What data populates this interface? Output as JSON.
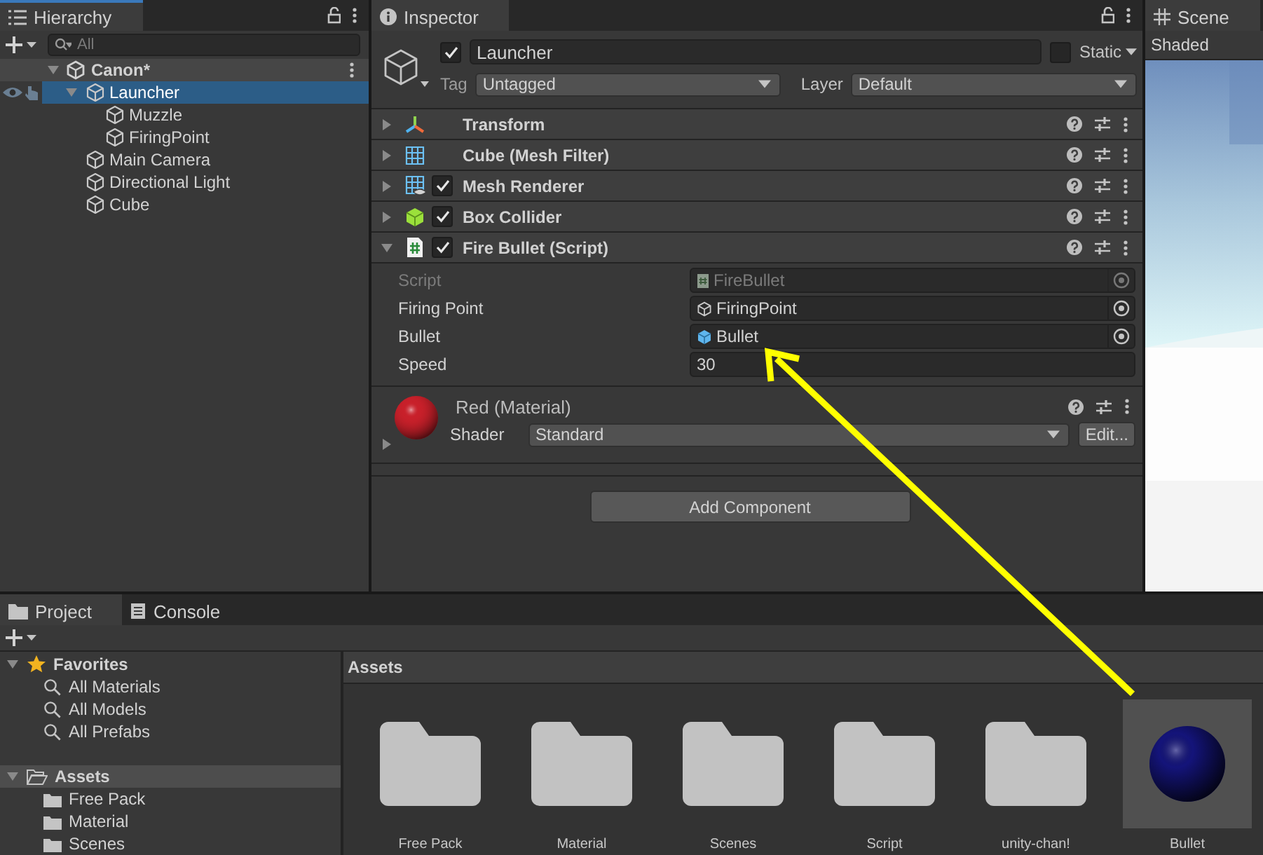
{
  "hierarchy": {
    "tab": {
      "label": "Hierarchy",
      "focused": true
    },
    "search": {
      "placeholder": "All"
    },
    "scene_root": {
      "label": "Canon*",
      "expanded": true
    },
    "items": [
      {
        "label": "Launcher",
        "selected": true,
        "expanded": true,
        "children": [
          {
            "label": "Muzzle",
            "selected": false
          },
          {
            "label": "FiringPoint",
            "selected": false
          }
        ]
      },
      {
        "label": "Main Camera",
        "selected": false
      },
      {
        "label": "Directional Light",
        "selected": false
      },
      {
        "label": "Cube",
        "selected": false
      }
    ]
  },
  "inspector": {
    "tab": {
      "label": "Inspector",
      "focused": false
    },
    "object": {
      "name": "Launcher",
      "active": true,
      "static_label": "Static",
      "static": false,
      "tag_label": "Tag",
      "tag": "Untagged",
      "layer_label": "Layer",
      "layer": "Default"
    },
    "components": [
      {
        "kind": "transform",
        "title": "Transform",
        "expanded": false
      },
      {
        "kind": "mesh-filter",
        "title": "Cube (Mesh Filter)",
        "expanded": false
      },
      {
        "kind": "mesh-renderer",
        "title": "Mesh Renderer",
        "enabled": true,
        "expanded": false
      },
      {
        "kind": "box-collider",
        "title": "Box Collider",
        "enabled": true,
        "expanded": false
      },
      {
        "kind": "script",
        "title": "Fire Bullet (Script)",
        "enabled": true,
        "expanded": true,
        "fields": [
          {
            "label": "Script",
            "value": "FireBullet",
            "kind": "script",
            "disabled": true
          },
          {
            "label": "Firing Point",
            "value": "FiringPoint",
            "kind": "gameobject",
            "disabled": false
          },
          {
            "label": "Bullet",
            "value": "Bullet",
            "kind": "prefab",
            "disabled": false
          },
          {
            "label": "Speed",
            "value": "30",
            "kind": "number",
            "disabled": false
          }
        ]
      }
    ],
    "material": {
      "name": "Red (Material)",
      "color": "#c8202a",
      "expanded": false,
      "shader_label": "Shader",
      "shader": "Standard",
      "edit_button": "Edit..."
    },
    "add_component": "Add Component"
  },
  "scene": {
    "tab": {
      "label": "Scene",
      "focused": false
    },
    "mode": "Shaded"
  },
  "project": {
    "tabs": [
      {
        "label": "Project",
        "kind": "project",
        "selected": true
      },
      {
        "label": "Console",
        "kind": "console",
        "selected": false
      }
    ],
    "sidebar": [
      {
        "label": "Favorites",
        "kind": "favorites",
        "expanded": true,
        "selected": false,
        "children": [
          {
            "label": "All Materials",
            "kind": "search",
            "selected": false
          },
          {
            "label": "All Models",
            "kind": "search",
            "selected": false
          },
          {
            "label": "All Prefabs",
            "kind": "search",
            "selected": false
          }
        ]
      },
      {
        "label": "Assets",
        "kind": "assets",
        "expanded": true,
        "selected": true,
        "children": [
          {
            "label": "Free Pack",
            "kind": "folder",
            "selected": false
          },
          {
            "label": "Material",
            "kind": "folder",
            "selected": false
          },
          {
            "label": "Scenes",
            "kind": "folder",
            "selected": false
          }
        ]
      }
    ],
    "breadcrumb": "Assets",
    "assets": [
      {
        "label": "Free Pack",
        "kind": "folder",
        "selected": false
      },
      {
        "label": "Material",
        "kind": "folder",
        "selected": false
      },
      {
        "label": "Scenes",
        "kind": "folder",
        "selected": false
      },
      {
        "label": "Script",
        "kind": "folder",
        "selected": false
      },
      {
        "label": "unity-chan!",
        "kind": "folder",
        "selected": false
      },
      {
        "label": "Bullet",
        "kind": "prefab",
        "color": "#14147a",
        "selected": true
      }
    ]
  }
}
